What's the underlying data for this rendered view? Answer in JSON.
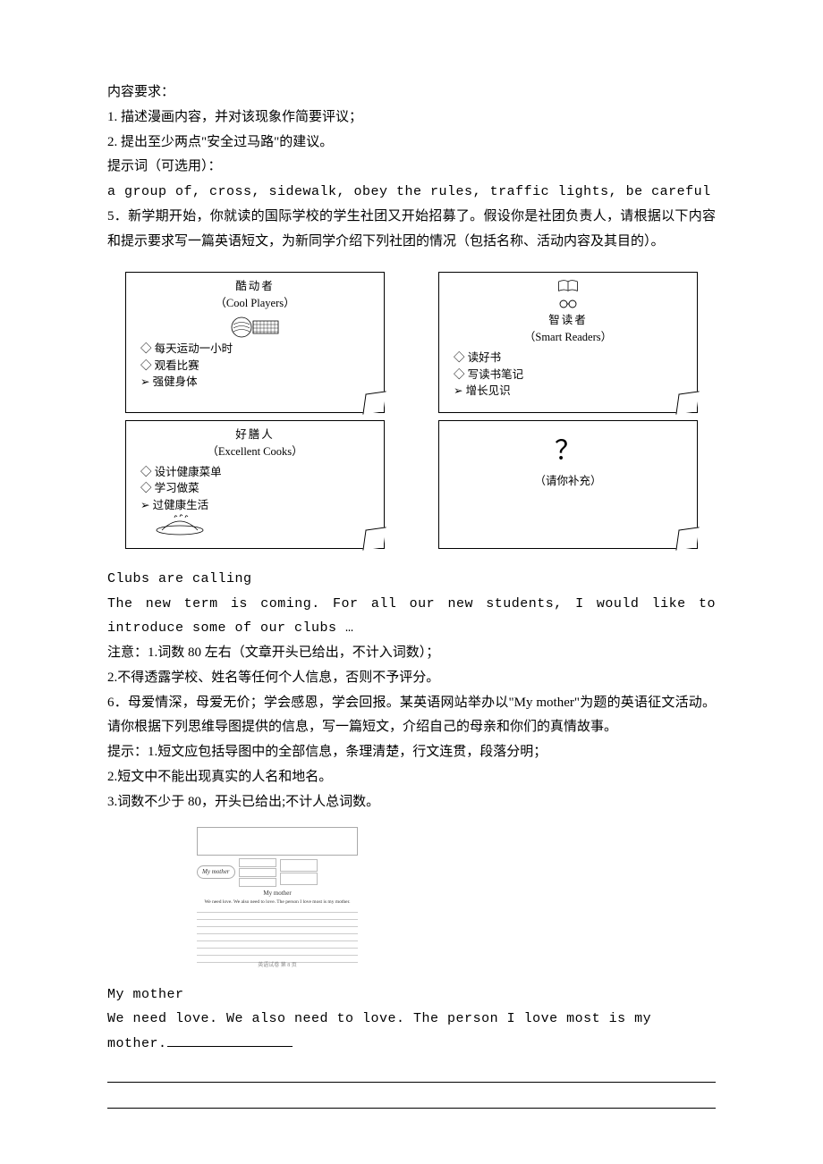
{
  "section_a": {
    "heading": "内容要求：",
    "item1": "1. 描述漫画内容，并对该现象作简要评议；",
    "item2": "2. 提出至少两点\"安全过马路\"的建议。",
    "hints_label": "提示词（可选用）：",
    "hints": "a group of, cross, sidewalk, obey the rules, traffic lights, be careful"
  },
  "q5": {
    "text": "5．新学期开始，你就读的国际学校的学生社团又开始招募了。假设你是社团负责人，请根据以下内容和提示要求写一篇英语短文，为新同学介绍下列社团的情况（包括名称、活动内容及其目的）。"
  },
  "cards": {
    "c1": {
      "cn": "酷动者",
      "en": "（Cool Players）",
      "l1": "◇ 每天运动一小时",
      "l2": "◇ 观看比赛",
      "l3": "➢ 强健身体"
    },
    "c2": {
      "cn": "智读者",
      "en": "（Smart Readers）",
      "l1": "◇ 读好书",
      "l2": "◇ 写读书笔记",
      "l3": "➢ 增长见识"
    },
    "c3": {
      "cn": "好膳人",
      "en": "（Excellent Cooks）",
      "l1": "◇ 设计健康菜单",
      "l2": "◇ 学习做菜",
      "l3": "➢ 过健康生活"
    },
    "c4": {
      "q": "？",
      "fill": "（请你补充）"
    }
  },
  "q5_followup": {
    "title": "Clubs are calling",
    "lead": "The new term is coming. For all our new students, I would like to introduce some of our clubs …",
    "note_label": "注意：",
    "note1": "1.词数 80 左右（文章开头已给出，不计入词数）；",
    "note2": "2.不得透露学校、姓名等任何个人信息，否则不予评分。"
  },
  "q6": {
    "text": "6．母爱情深，母爱无价；学会感恩，学会回报。某英语网站举办以\"My mother\"为题的英语征文活动。请你根据下列思维导图提供的信息，写一篇短文，介绍自己的母亲和你们的真情故事。",
    "tips_label": "提示：",
    "tip1": "1.短文应包括导图中的全部信息，条理清楚，行文连贯，段落分明；",
    "tip2": "2.短文中不能出现真实的人名和地名。",
    "tip3": "3.词数不少于 80，开头已给出;不计人总词数。"
  },
  "worksheet": {
    "bubble": "My mother",
    "essay_title": "My mother",
    "essay_lead": "We need love. We also need to love. The person I love most is my mother.",
    "footer": "英语试卷 第 8 页"
  },
  "essay": {
    "title": "My mother",
    "lead_parts": {
      "a": "We  need  love.  We  also  need  to  love.  The  person  I  love  most  is  my ",
      "b": "mother."
    }
  }
}
